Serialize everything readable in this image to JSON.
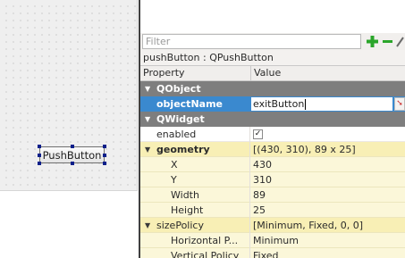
{
  "form": {
    "pushbutton_text": "PushButton"
  },
  "filter": {
    "placeholder": "Filter",
    "add_icon": "plus-icon",
    "remove_icon": "minus-icon",
    "config_icon": "wrench-icon"
  },
  "object_label": "pushButton : QPushButton",
  "columns": {
    "property": "Property",
    "value": "Value"
  },
  "rows": [
    {
      "name": "QObject",
      "type": "group"
    },
    {
      "name": "objectName",
      "value": "exitButton",
      "type": "edit"
    },
    {
      "name": "QWidget",
      "type": "group"
    },
    {
      "name": "enabled",
      "value": "✓",
      "type": "check"
    },
    {
      "name": "geometry",
      "value": "[(430, 310), 89 x 25]",
      "type": "expanded"
    },
    {
      "name": "X",
      "value": "430",
      "type": "child"
    },
    {
      "name": "Y",
      "value": "310",
      "type": "child"
    },
    {
      "name": "Width",
      "value": "89",
      "type": "child"
    },
    {
      "name": "Height",
      "value": "25",
      "type": "child"
    },
    {
      "name": "sizePolicy",
      "value": "[Minimum, Fixed, 0, 0]",
      "type": "expanded"
    },
    {
      "name": "Horizontal P...",
      "value": "Minimum",
      "type": "child"
    },
    {
      "name": "Vertical Policy",
      "value": "Fixed",
      "type": "child"
    }
  ],
  "colors": {
    "selection": "#3a89cf",
    "group_header": "#7e7e7e",
    "property_yellow": "#fbf7d9",
    "add_green": "#2aa52a"
  }
}
